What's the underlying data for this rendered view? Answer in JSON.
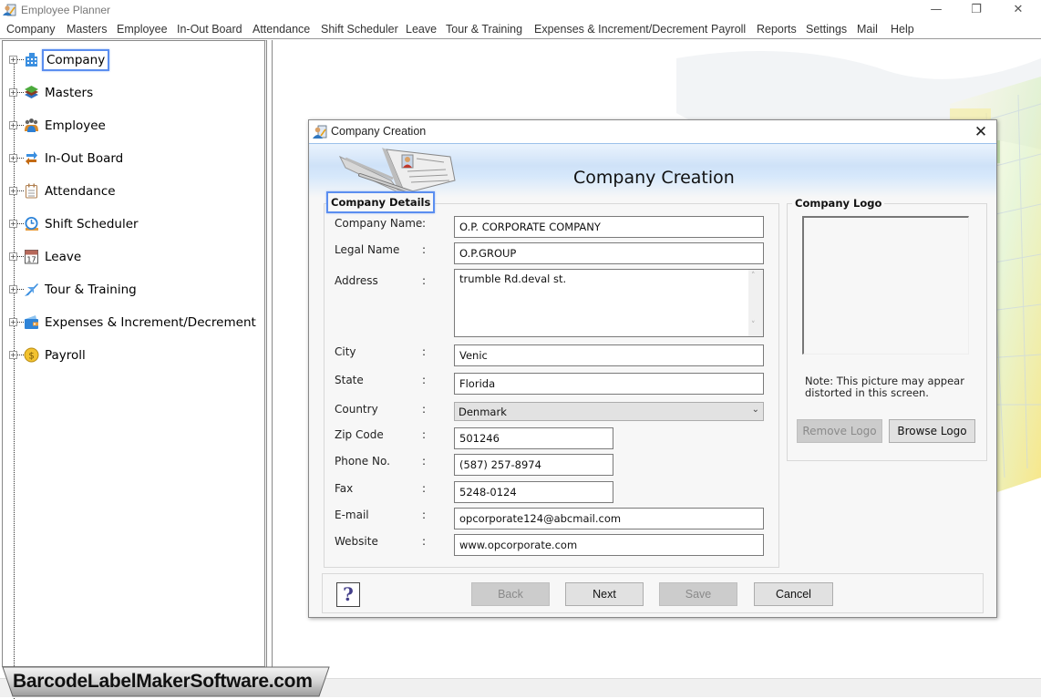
{
  "app": {
    "title": "Employee Planner",
    "window_controls": {
      "minimize": "—",
      "maximize": "❐",
      "close": "✕"
    }
  },
  "menu": [
    "Company",
    "Masters",
    "Employee",
    "In-Out Board",
    "Attendance",
    "Shift Scheduler",
    "Leave",
    "Tour & Training",
    "Expenses & Increment/Decrement",
    "Payroll",
    "Reports",
    "Settings",
    "Mail",
    "Help"
  ],
  "tree": {
    "expander": "+",
    "items": [
      {
        "label": "Company",
        "icon": "building-icon",
        "selected": true
      },
      {
        "label": "Masters",
        "icon": "layers-icon"
      },
      {
        "label": "Employee",
        "icon": "people-icon"
      },
      {
        "label": "In-Out Board",
        "icon": "swap-arrows-icon"
      },
      {
        "label": "Attendance",
        "icon": "clipboard-icon"
      },
      {
        "label": "Shift Scheduler",
        "icon": "clock-icon"
      },
      {
        "label": "Leave",
        "icon": "calendar-icon",
        "icon_text": "17"
      },
      {
        "label": "Tour & Training",
        "icon": "airplane-icon"
      },
      {
        "label": "Expenses & Increment/Decrement",
        "icon": "wallet-icon"
      },
      {
        "label": "Payroll",
        "icon": "dollar-coin-icon",
        "icon_text": "$"
      }
    ]
  },
  "dialog": {
    "title": "Company Creation",
    "close": "✕",
    "banner_title": "Company Creation",
    "details_group": "Company Details",
    "logo_group": "Company Logo",
    "fields": {
      "company_name": {
        "label": "Company Name",
        "value": "O.P. CORPORATE COMPANY"
      },
      "legal_name": {
        "label": "Legal Name",
        "value": "O.P.GROUP"
      },
      "address": {
        "label": "Address",
        "value": "trumble Rd.deval st."
      },
      "city": {
        "label": "City",
        "value": "Venic"
      },
      "state": {
        "label": "State",
        "value": "Florida"
      },
      "country": {
        "label": "Country",
        "value": "Denmark"
      },
      "zip": {
        "label": "Zip Code",
        "value": "501246"
      },
      "phone": {
        "label": "Phone No.",
        "value": "(587) 257-8974"
      },
      "fax": {
        "label": "Fax",
        "value": "5248-0124"
      },
      "email": {
        "label": "E-mail",
        "value": "opcorporate124@abcmail.com"
      },
      "website": {
        "label": "Website",
        "value": "www.opcorporate.com"
      }
    },
    "colon": ":",
    "logo_note": "Note: This picture may appear distorted in this screen.",
    "buttons": {
      "remove_logo": "Remove Logo",
      "browse_logo": "Browse Logo",
      "help": "?",
      "back": "Back",
      "next": "Next",
      "save": "Save",
      "cancel": "Cancel"
    },
    "scroll_up": "˄",
    "scroll_down": "˅",
    "caret": "⌄"
  },
  "watermark": "BarcodeLabelMakerSoftware.com"
}
